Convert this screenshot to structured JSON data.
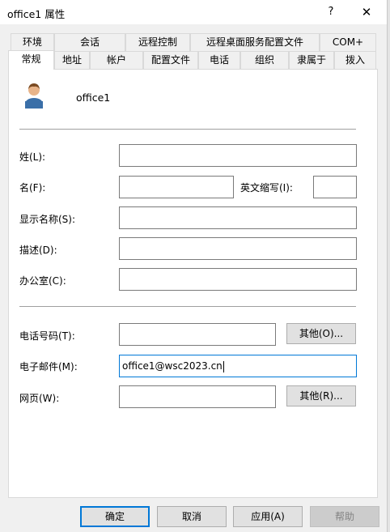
{
  "window": {
    "title": "office1 属性",
    "help": "?",
    "close": "✕"
  },
  "tabs_row1": [
    "环境",
    "会话",
    "远程控制",
    "远程桌面服务配置文件",
    "COM+"
  ],
  "tabs_row2": [
    "常规",
    "地址",
    "帐户",
    "配置文件",
    "电话",
    "组织",
    "隶属于",
    "拨入"
  ],
  "user": {
    "name": "office1"
  },
  "fields": {
    "last_name_label": "姓(L):",
    "first_name_label": "名(F):",
    "initials_label": "英文缩写(I):",
    "display_name_label": "显示名称(S):",
    "description_label": "描述(D):",
    "office_label": "办公室(C):",
    "phone_label": "电话号码(T):",
    "email_label": "电子邮件(M):",
    "email_value": "office1@wsc2023.cn",
    "webpage_label": "网页(W):",
    "other_phone_button": "其他(O)...",
    "other_web_button": "其他(R)..."
  },
  "buttons": {
    "ok": "确定",
    "cancel": "取消",
    "apply": "应用(A)",
    "help": "帮助"
  }
}
